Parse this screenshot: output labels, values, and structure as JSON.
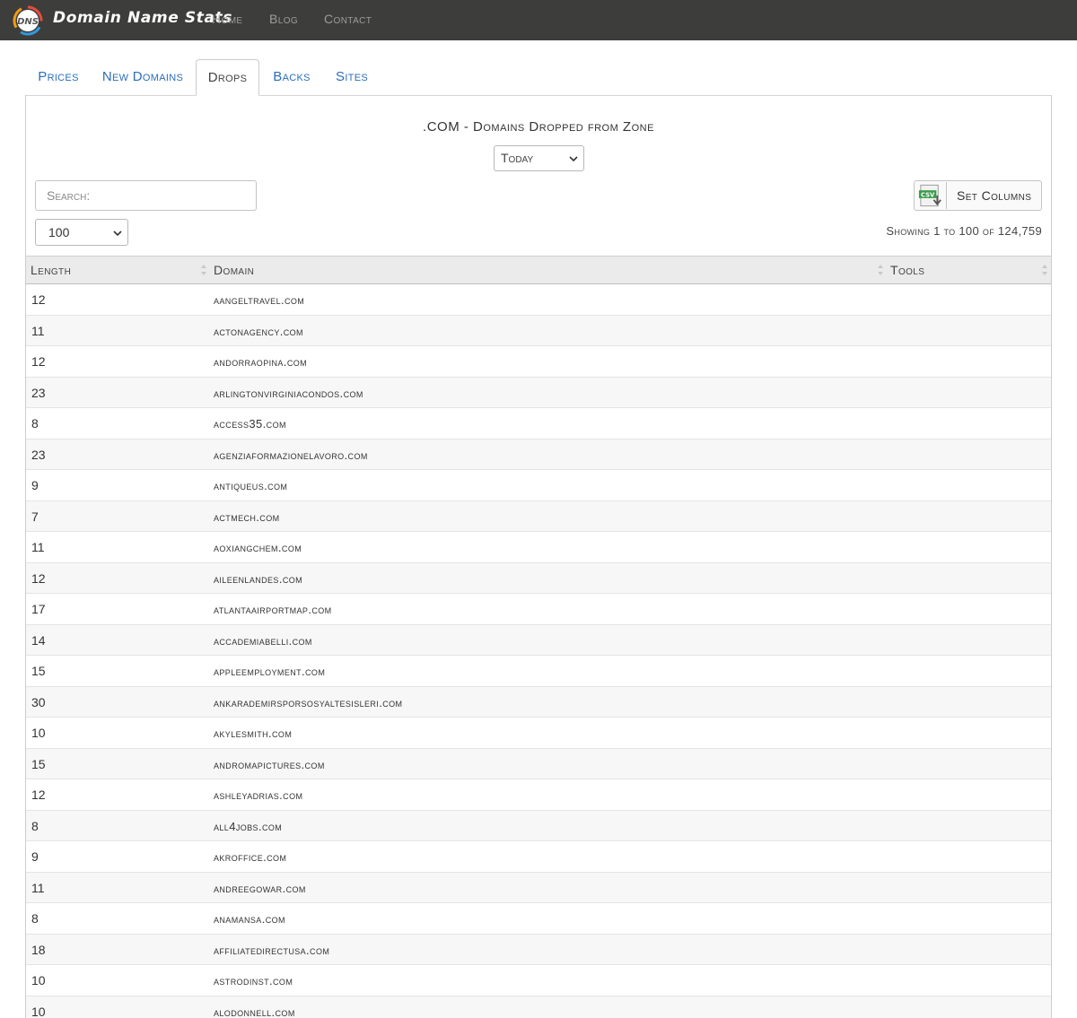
{
  "navbar": {
    "logo_text": "DNS",
    "brand": "Domain Name Stats",
    "links": [
      "Home",
      "Blog",
      "Contact"
    ]
  },
  "tabs": [
    {
      "label": "Prices",
      "active": false
    },
    {
      "label": "New Domains",
      "active": false
    },
    {
      "label": "Drops",
      "active": true
    },
    {
      "label": "Backs",
      "active": false
    },
    {
      "label": "Sites",
      "active": false
    }
  ],
  "panel": {
    "title": ".COM - Domains Dropped from Zone",
    "period_selected": "Today",
    "search_placeholder": "Search:",
    "set_columns_label": "Set Columns",
    "page_size_selected": "100",
    "showing_text": "Showing 1 to 100 of 124,759"
  },
  "table": {
    "columns": [
      "Length",
      "Domain",
      "Tools"
    ],
    "rows": [
      {
        "length": "12",
        "domain": "aangeltravel.com"
      },
      {
        "length": "11",
        "domain": "actonagency.com"
      },
      {
        "length": "12",
        "domain": "andorraopina.com"
      },
      {
        "length": "23",
        "domain": "arlingtonvirginiacondos.com"
      },
      {
        "length": "8",
        "domain": "access35.com"
      },
      {
        "length": "23",
        "domain": "agenziaformazionelavoro.com"
      },
      {
        "length": "9",
        "domain": "antiqueus.com"
      },
      {
        "length": "7",
        "domain": "actmech.com"
      },
      {
        "length": "11",
        "domain": "aoxiangchem.com"
      },
      {
        "length": "12",
        "domain": "aileenlandes.com"
      },
      {
        "length": "17",
        "domain": "atlantaairportmap.com"
      },
      {
        "length": "14",
        "domain": "accademiabelli.com"
      },
      {
        "length": "15",
        "domain": "appleemployment.com"
      },
      {
        "length": "30",
        "domain": "ankarademirsporsosyaltesisleri.com"
      },
      {
        "length": "10",
        "domain": "akylesmith.com"
      },
      {
        "length": "15",
        "domain": "andromapictures.com"
      },
      {
        "length": "12",
        "domain": "ashleyadrias.com"
      },
      {
        "length": "8",
        "domain": "all4jobs.com"
      },
      {
        "length": "9",
        "domain": "akroffice.com"
      },
      {
        "length": "11",
        "domain": "andreegowar.com"
      },
      {
        "length": "8",
        "domain": "anamansa.com"
      },
      {
        "length": "18",
        "domain": "affiliatedirectusa.com"
      },
      {
        "length": "10",
        "domain": "astrodinst.com"
      },
      {
        "length": "10",
        "domain": "alodonnell.com"
      }
    ]
  },
  "colors": {
    "navbar_bg": "#3d3d3b",
    "link_blue": "#2a6ebb",
    "header_bg": "#ebebeb"
  }
}
